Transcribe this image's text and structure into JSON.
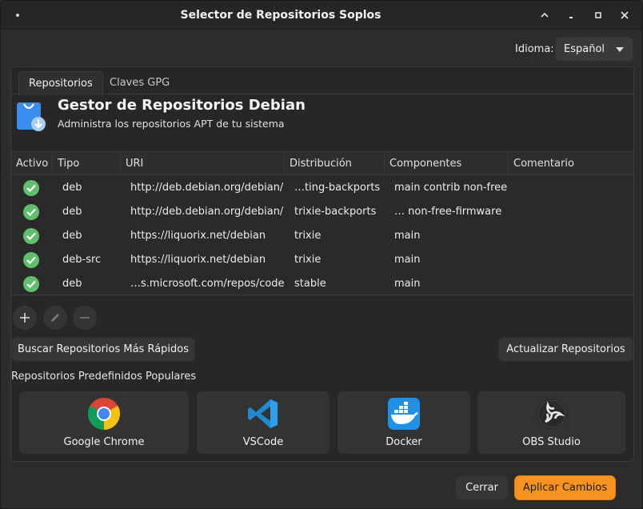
{
  "window": {
    "title": "Selector de Repositorios Soplos"
  },
  "language": {
    "label": "Idioma:",
    "selected": "Español"
  },
  "tabs": [
    {
      "label": "Repositorios",
      "active": true
    },
    {
      "label": "Claves GPG",
      "active": false
    }
  ],
  "header": {
    "title": "Gestor de Repositorios Debian",
    "subtitle": "Administra los repositorios APT de tu sistema"
  },
  "table": {
    "columns": [
      "Activo",
      "Tipo",
      "URI",
      "Distribución",
      "Componentes",
      "Comentario"
    ],
    "rows": [
      {
        "active": true,
        "type": "deb",
        "uri": "http://deb.debian.org/debian/",
        "dist": "…ting-backports",
        "components": "main contrib non-free",
        "comment": ""
      },
      {
        "active": true,
        "type": "deb",
        "uri": "http://deb.debian.org/debian/",
        "dist": "trixie-backports",
        "components": "…  non-free-firmware",
        "comment": ""
      },
      {
        "active": true,
        "type": "deb",
        "uri": "https://liquorix.net/debian",
        "dist": "trixie",
        "components": "main",
        "comment": ""
      },
      {
        "active": true,
        "type": "deb-src",
        "uri": "https://liquorix.net/debian",
        "dist": "trixie",
        "components": "main",
        "comment": ""
      },
      {
        "active": true,
        "type": "deb",
        "uri": "…s.microsoft.com/repos/code",
        "dist": "stable",
        "components": "main",
        "comment": ""
      }
    ]
  },
  "actions": {
    "find_fastest": "Buscar Repositorios Más Rápidos",
    "update": "Actualizar Repositorios"
  },
  "popular": {
    "label": "Repositorios Predefinidos Populares",
    "apps": [
      {
        "name": "Google Chrome",
        "icon": "chrome-icon"
      },
      {
        "name": "VSCode",
        "icon": "vscode-icon"
      },
      {
        "name": "Docker",
        "icon": "docker-icon"
      },
      {
        "name": "OBS Studio",
        "icon": "obs-icon"
      }
    ]
  },
  "footer": {
    "close": "Cerrar",
    "apply": "Aplicar Cambios"
  },
  "colors": {
    "accent": "#f7931e",
    "active_check": "#5fbf6d"
  }
}
